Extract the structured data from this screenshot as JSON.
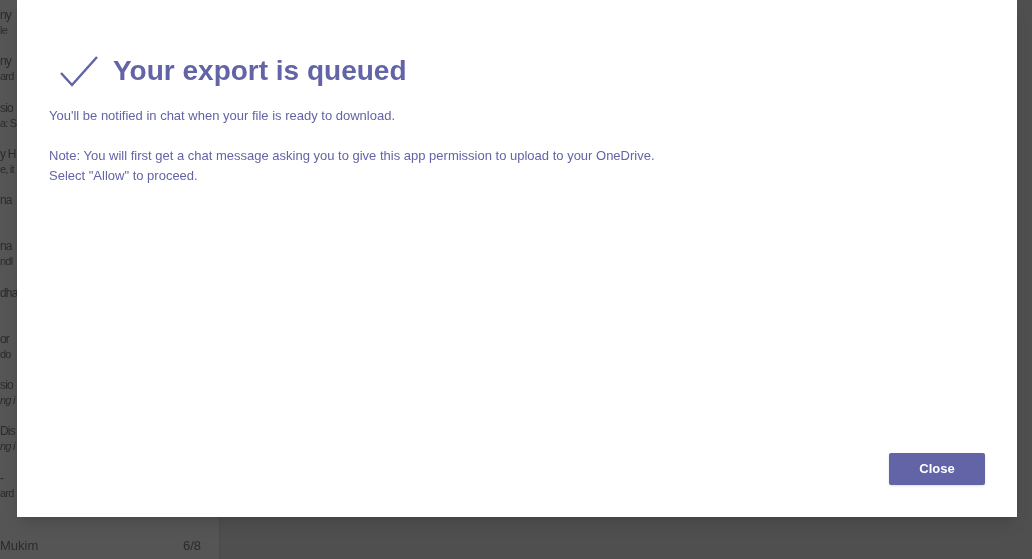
{
  "background_list": [
    {
      "name": "ny",
      "preview": "le"
    },
    {
      "name": "ny",
      "preview": "ard"
    },
    {
      "name": "sio",
      "preview": "a: S"
    },
    {
      "name": "y H",
      "preview": "e, it"
    },
    {
      "name": "na"
    },
    {
      "name": "na",
      "preview": "ndl"
    },
    {
      "name": "dha"
    },
    {
      "name": "or",
      "preview": "do"
    },
    {
      "name": "sio",
      "preview": "ng i",
      "italic": true
    },
    {
      "name": "Dis",
      "preview": "ng i",
      "italic": true
    },
    {
      "name": "-",
      "preview": "ard"
    }
  ],
  "bottom_item": {
    "name": "Mukim",
    "count": "6/8"
  },
  "dialog": {
    "title": "Your export is queued",
    "paragraphs": [
      "You'll be notified in chat when your file is ready to download.",
      "Note: You will first get a chat message asking you to give this app permission to upload to your OneDrive.\nSelect \"Allow\" to proceed."
    ],
    "buttons": [
      {
        "label": "Close"
      }
    ]
  }
}
